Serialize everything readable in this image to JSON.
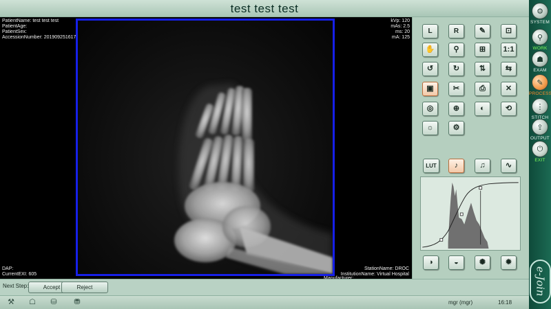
{
  "window": {
    "title": "test test test"
  },
  "overlay": {
    "patient_name": "PatientName: test test test",
    "patient_age": "PatientAge:",
    "patient_sex": "PatientSex:",
    "accession": "AccessionNumber: 20190925161748015",
    "kvp": "kVp: 120",
    "mas": "mAs: 2.5",
    "ms": "ms: 20",
    "ma": "mA: 125",
    "dap": "DAP:",
    "current_exi": "CurrentEXI: 605",
    "station": "StationName: DROC",
    "institution": "InstitutionName: Virtual Hospital",
    "manufacturer": "Manufacturer:"
  },
  "tools": {
    "left_marker": "L",
    "right_marker": "R",
    "lut": "LUT"
  },
  "nav": {
    "system": "SYSTEM",
    "worklist": "WORK",
    "exam": "EXAM",
    "process": "PROCESS",
    "stitch": "STITCH",
    "output": "OUTPUT",
    "exit": "EXIT",
    "brand": "e-Join"
  },
  "next_step": {
    "label": "Next Step:",
    "accept": "Accept",
    "reject": "Reject"
  },
  "status": {
    "user": "mgr (mgr)",
    "time": "16:18"
  },
  "colors": {
    "image_border": "#1620e8",
    "accent_active": "#f09a4a",
    "sidebar": "#0f4a3a"
  }
}
